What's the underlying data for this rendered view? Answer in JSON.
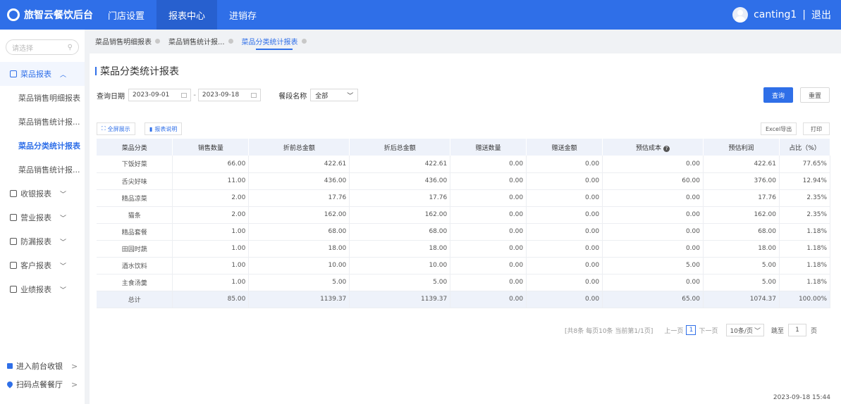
{
  "topbar": {
    "brand": "旅智云餐饮后台",
    "nav": [
      "门店设置",
      "报表中心",
      "进销存"
    ],
    "active_nav": 1,
    "username": "canting1",
    "divider": "|",
    "logout": "退出"
  },
  "sidebar": {
    "search_placeholder": "请选择",
    "groups": [
      {
        "label": "菜品报表",
        "expanded": true,
        "children": [
          "菜品销售明细报表",
          "菜品销售统计报...",
          "菜品分类统计报表",
          "菜品销售统计报..."
        ],
        "active_child": 2
      },
      {
        "label": "收银报表"
      },
      {
        "label": "营业报表"
      },
      {
        "label": "防漏报表"
      },
      {
        "label": "客户报表"
      },
      {
        "label": "业绩报表"
      }
    ],
    "bottom": [
      "进入前台收银",
      "扫码点餐餐厅"
    ]
  },
  "breadcrumb": [
    "菜品销售明细报表",
    "菜品销售统计报...",
    "菜品分类统计报表"
  ],
  "page": {
    "title": "菜品分类统计报表",
    "filter": {
      "date_label": "查询日期",
      "start_date": "2023-09-01",
      "end_date": "2023-09-18",
      "date_sep": "-",
      "segment_label": "餐段名称",
      "segment_value": "全部"
    },
    "query_btn": "查询",
    "reset_btn": "重置",
    "fullscreen_btn": "全屏展示",
    "explain_btn": "报表说明",
    "excel_btn": "Excel导出",
    "print_btn": "打印"
  },
  "table": {
    "headers": [
      "菜品分类",
      "销售数量",
      "折前总金额",
      "折后总金额",
      "赠送数量",
      "赠送金额",
      "预估成本",
      "预估利润",
      "占比（%）"
    ],
    "rows": [
      [
        "下饭好菜",
        "66.00",
        "422.61",
        "422.61",
        "0.00",
        "0.00",
        "0.00",
        "422.61",
        "77.65%"
      ],
      [
        "舌尖好味",
        "11.00",
        "436.00",
        "436.00",
        "0.00",
        "0.00",
        "60.00",
        "376.00",
        "12.94%"
      ],
      [
        "精品凉菜",
        "2.00",
        "17.76",
        "17.76",
        "0.00",
        "0.00",
        "0.00",
        "17.76",
        "2.35%"
      ],
      [
        "猫条",
        "2.00",
        "162.00",
        "162.00",
        "0.00",
        "0.00",
        "0.00",
        "162.00",
        "2.35%"
      ],
      [
        "精品套餐",
        "1.00",
        "68.00",
        "68.00",
        "0.00",
        "0.00",
        "0.00",
        "68.00",
        "1.18%"
      ],
      [
        "田园时蔬",
        "1.00",
        "18.00",
        "18.00",
        "0.00",
        "0.00",
        "0.00",
        "18.00",
        "1.18%"
      ],
      [
        "酒水饮料",
        "1.00",
        "10.00",
        "10.00",
        "0.00",
        "0.00",
        "5.00",
        "5.00",
        "1.18%"
      ],
      [
        "主食汤羹",
        "1.00",
        "5.00",
        "5.00",
        "0.00",
        "0.00",
        "0.00",
        "5.00",
        "1.18%"
      ]
    ],
    "total": [
      "总计",
      "85.00",
      "1139.37",
      "1139.37",
      "0.00",
      "0.00",
      "65.00",
      "1074.37",
      "100.00%"
    ]
  },
  "pager": {
    "summary": "[共8条 每页10条 当前第1/1页]",
    "prev": "上一页",
    "current": "1",
    "next": "下一页",
    "page_size": "10条/页",
    "jump_label": "跳至",
    "jump_value": "1",
    "page_unit": "页"
  },
  "timestamp": "2023-09-18 15:44",
  "colors": {
    "primary": "#2f6fe8",
    "header_bg": "#eef2fa"
  }
}
